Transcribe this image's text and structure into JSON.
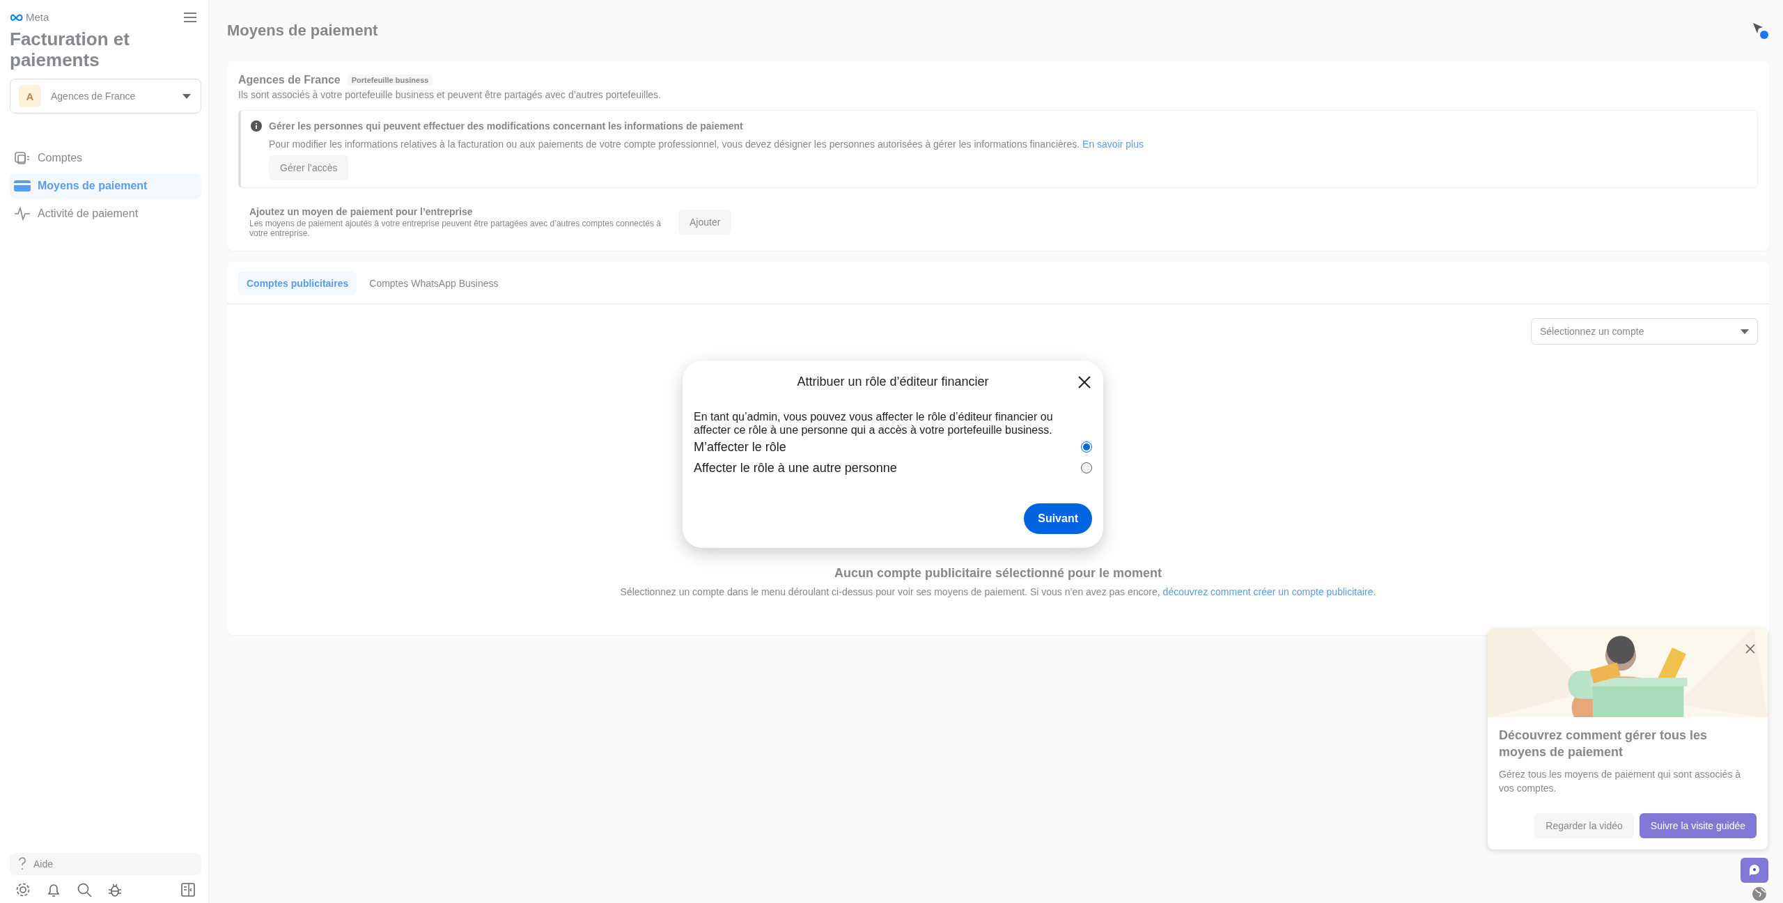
{
  "sidebar": {
    "brand": "Meta",
    "title": "Facturation et paiements",
    "account": {
      "initial": "A",
      "name": "Agences de France"
    },
    "items": [
      {
        "label": "Comptes",
        "kind": "accounts",
        "selected": false
      },
      {
        "label": "Moyens de paiement",
        "kind": "card",
        "selected": true
      },
      {
        "label": "Activité de paiement",
        "kind": "activity",
        "selected": false
      }
    ],
    "help": "Aide"
  },
  "header": {
    "title": "Moyens de paiement"
  },
  "business": {
    "name": "Agences de France",
    "badge": "Portefeuille business",
    "description": "Ils sont associés à votre portefeuille business et peuvent être partagés avec d’autres portefeuilles.",
    "notice": {
      "title": "Gérer les personnes qui peuvent effectuer des modifications concernant les informations de paiement",
      "text": "Pour modifier les informations relatives à la facturation ou aux paiements de votre compte professionnel, vous devez désigner les personnes autorisées à gérer les informations financières.",
      "link": "En savoir plus",
      "button": "Gérer l’accès"
    },
    "add": {
      "title": "Ajoutez un moyen de paiement pour l’entreprise",
      "text": "Les moyens de paiement ajoutés à votre entreprise peuvent être partagées avec d’autres comptes connectés à votre entreprise.",
      "button": "Ajouter"
    }
  },
  "tabs": [
    {
      "label": "Comptes publicitaires",
      "selected": true
    },
    {
      "label": "Comptes WhatsApp Business",
      "selected": false
    }
  ],
  "account_select": {
    "placeholder": "Sélectionnez un compte"
  },
  "empty": {
    "title": "Aucun compte publicitaire sélectionné pour le moment",
    "text": "Sélectionnez un compte dans le menu déroulant ci-dessus pour voir ses moyens de paiement. Si vous n’en avez pas encore,",
    "link": "découvrez comment créer un compte publicitaire."
  },
  "promo": {
    "title": "Découvrez comment gérer tous les moyens de paiement",
    "text": "Gérez tous les moyens de paiement qui sont associés à vos comptes.",
    "buttons": [
      {
        "label": "Regarder la vidéo",
        "kind": "secondary"
      },
      {
        "label": "Suivre la visite guidée",
        "kind": "primary"
      }
    ]
  },
  "dialog": {
    "title": "Attribuer un rôle d’éditeur financier",
    "text": "En tant qu’admin, vous pouvez vous affecter le rôle d’éditeur financier ou affecter ce rôle à une personne qui a accès à votre portefeuille business.",
    "options": [
      {
        "label": "M’affecter le rôle",
        "selected": true
      },
      {
        "label": "Affecter le rôle à une autre personne",
        "selected": false
      }
    ],
    "button": "Suivant"
  }
}
